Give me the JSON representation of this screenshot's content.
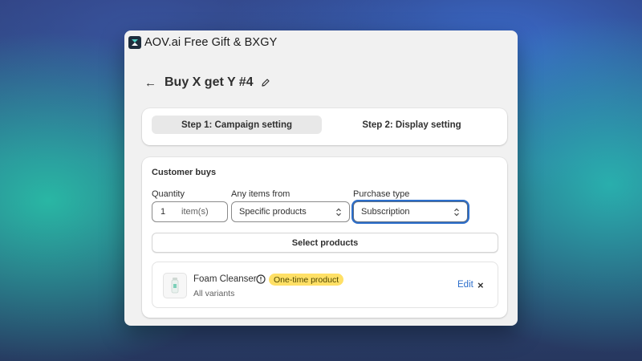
{
  "app": {
    "title": "AOV.ai Free Gift & BXGY"
  },
  "page": {
    "title": "Buy X get Y #4"
  },
  "steps": [
    {
      "label": "Step 1: Campaign setting",
      "active": true
    },
    {
      "label": "Step 2: Display setting",
      "active": false
    }
  ],
  "customer_buys": {
    "title": "Customer buys",
    "quantity": {
      "label": "Quantity",
      "value": "1",
      "suffix": "item(s)"
    },
    "items_from": {
      "label": "Any items from",
      "value": "Specific products"
    },
    "purchase_type": {
      "label": "Purchase type",
      "value": "Subscription"
    },
    "select_products_label": "Select products",
    "product": {
      "name": "Foam Cleanser",
      "badge": "One-time product",
      "variants": "All variants",
      "edit_label": "Edit",
      "remove_label": "×"
    }
  },
  "colors": {
    "accent": "#2c6ecb",
    "badge": "#ffe066"
  }
}
